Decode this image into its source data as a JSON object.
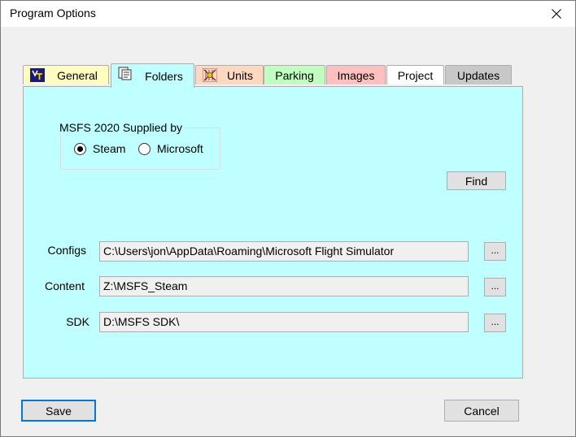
{
  "window": {
    "title": "Program Options"
  },
  "tabs": [
    {
      "label": "General",
      "color": "#fffdc0",
      "icon": "general-icon"
    },
    {
      "label": "Folders",
      "color": "#c0ffff",
      "icon": "folders-icon",
      "active": true
    },
    {
      "label": "Units",
      "color": "#ffd8c0",
      "icon": "units-icon"
    },
    {
      "label": "Parking",
      "color": "#c0ffc0"
    },
    {
      "label": "Images",
      "color": "#ffc0c0"
    },
    {
      "label": "Project",
      "color": "#ffffff"
    },
    {
      "label": "Updates",
      "color": "#c8c8c8"
    }
  ],
  "folders": {
    "group_title": "MSFS 2020 Supplied by",
    "options": [
      {
        "label": "Steam",
        "selected": true
      },
      {
        "label": "Microsoft",
        "selected": false
      }
    ],
    "find_label": "Find",
    "fields": [
      {
        "label": "Configs",
        "value": "C:\\Users\\jon\\AppData\\Roaming\\Microsoft Flight Simulator",
        "browse": "..."
      },
      {
        "label": "Content",
        "value": "Z:\\MSFS_Steam",
        "browse": "..."
      },
      {
        "label": "SDK",
        "value": "D:\\MSFS SDK\\",
        "browse": "..."
      }
    ]
  },
  "footer": {
    "save_label": "Save",
    "cancel_label": "Cancel"
  }
}
